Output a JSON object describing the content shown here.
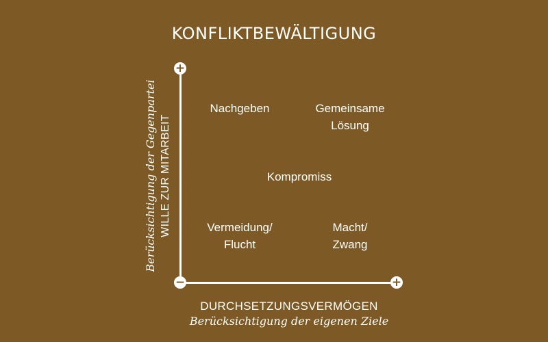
{
  "colors": {
    "background": "#7d5a25",
    "foreground": "#ffffff"
  },
  "title": "KONFLIKTBEWÄLTIGUNG",
  "y_axis": {
    "main": "WILLE ZUR MITARBEIT",
    "sub": "Berücksichtigung der Gegenpartei",
    "top_symbol": "+",
    "origin_symbol": "−"
  },
  "x_axis": {
    "main": "DURCHSETZUNGSVERMÖGEN",
    "sub": "Berücksichtigung der eigenen Ziele",
    "end_symbol": "+"
  },
  "regions": {
    "top_left": "Nachgeben",
    "top_right": "Gemeinsame\nLösung",
    "center": "Kompromiss",
    "bottom_left": "Vermeidung/\nFlucht",
    "bottom_right": "Macht/\nZwang"
  }
}
